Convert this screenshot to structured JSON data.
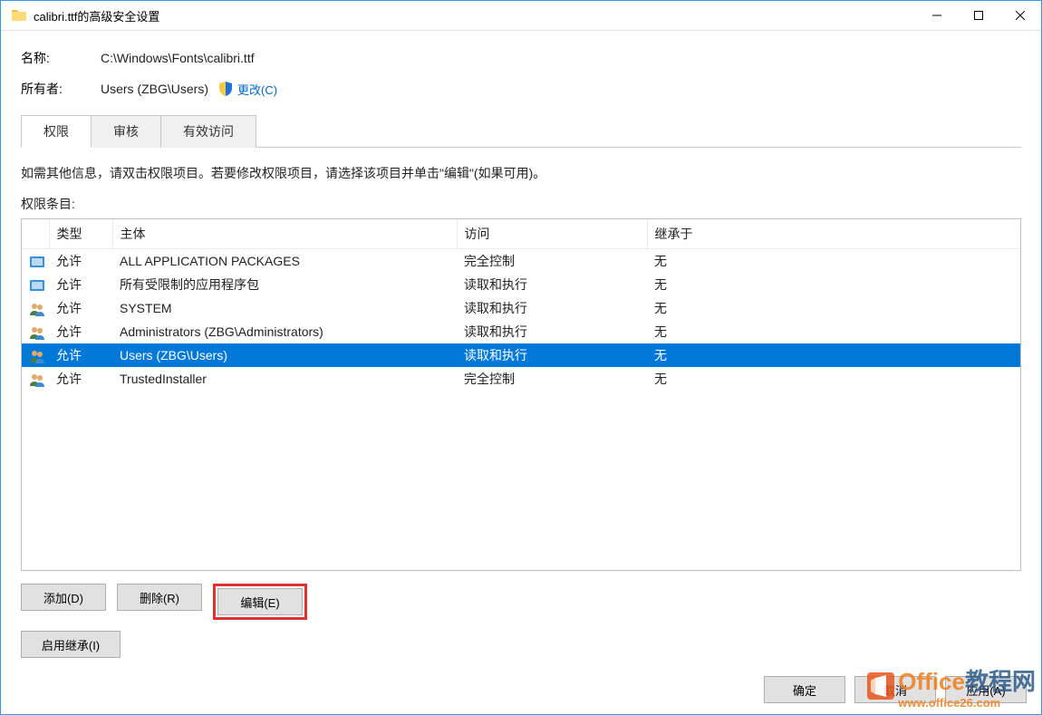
{
  "window": {
    "title": "calibri.ttf的高级安全设置"
  },
  "info": {
    "name_label": "名称:",
    "name_value": "C:\\Windows\\Fonts\\calibri.ttf",
    "owner_label": "所有者:",
    "owner_value": "Users (ZBG\\Users)",
    "change_link": "更改(C)"
  },
  "tabs": {
    "permissions": "权限",
    "auditing": "审核",
    "effective": "有效访问"
  },
  "description": "如需其他信息，请双击权限项目。若要修改权限项目，请选择该项目并单击\"编辑\"(如果可用)。",
  "section_label": "权限条目:",
  "columns": {
    "icon": "",
    "type": "类型",
    "principal": "主体",
    "access": "访问",
    "inherited": "继承于"
  },
  "entries": [
    {
      "icon": "package",
      "type": "允许",
      "principal": "ALL APPLICATION PACKAGES",
      "access": "完全控制",
      "inherited": "无",
      "selected": false
    },
    {
      "icon": "package",
      "type": "允许",
      "principal": "所有受限制的应用程序包",
      "access": "读取和执行",
      "inherited": "无",
      "selected": false
    },
    {
      "icon": "group",
      "type": "允许",
      "principal": "SYSTEM",
      "access": "读取和执行",
      "inherited": "无",
      "selected": false
    },
    {
      "icon": "group",
      "type": "允许",
      "principal": "Administrators (ZBG\\Administrators)",
      "access": "读取和执行",
      "inherited": "无",
      "selected": false
    },
    {
      "icon": "group",
      "type": "允许",
      "principal": "Users (ZBG\\Users)",
      "access": "读取和执行",
      "inherited": "无",
      "selected": true
    },
    {
      "icon": "group",
      "type": "允许",
      "principal": "TrustedInstaller",
      "access": "完全控制",
      "inherited": "无",
      "selected": false
    }
  ],
  "buttons": {
    "add": "添加(D)",
    "remove": "删除(R)",
    "edit": "编辑(E)",
    "enable_inherit": "启用继承(I)"
  },
  "footer": {
    "ok": "确定",
    "cancel": "取消",
    "apply": "应用(A)"
  },
  "watermark": {
    "brand1": "Office",
    "brand2": "教程网",
    "url": "www.office26.com"
  }
}
